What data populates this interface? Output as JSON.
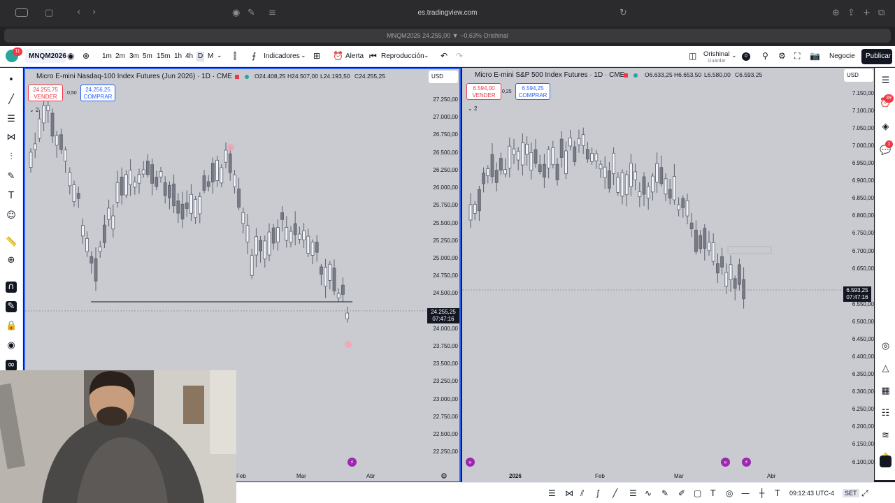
{
  "browser": {
    "url": "es.tradingview.com",
    "tab_title": "MNQM2026 24.255,00 ▼ −0.63% Orishinal"
  },
  "toolbar": {
    "symbol": "MNQM2026",
    "intervals": [
      "1m",
      "2m",
      "3m",
      "5m",
      "15m",
      "1h",
      "4h",
      "D",
      "M"
    ],
    "indicators_label": "Indicadores",
    "alert_label": "Alerta",
    "replay_label": "Reproducción",
    "layout_name": "Orishinal",
    "layout_sub": "Guardar",
    "layout_count": "0",
    "trade_label": "Negocie",
    "publish_label": "Publicar",
    "notif_count": "11"
  },
  "right_badges": {
    "alerts": "39",
    "chat": "1"
  },
  "left_pane": {
    "title": "Micro E-mini Nasdaq-100 Index Futures (Jun 2026) · 1D · CME",
    "open": "O24.408,25",
    "high": "H24.507,00",
    "low": "L24.193,50",
    "close": "C24.255,25",
    "sell_price": "24.255,75",
    "sell_label": "VENDER",
    "buy_price": "24.256,25",
    "buy_label": "COMPRAR",
    "spread": "0,50",
    "badge": "2",
    "currency": "USD",
    "ticks": [
      "27.250,00",
      "27.000,00",
      "26.750,00",
      "26.500,00",
      "26.250,00",
      "26.000,00",
      "25.750,00",
      "25.500,00",
      "25.250,00",
      "25.000,00",
      "24.750,00",
      "24.500,00",
      "24.000,00",
      "23.750,00",
      "23.500,00",
      "23.250,00",
      "23.000,00",
      "22.750,00",
      "22.500,00",
      "22.250,00"
    ],
    "last_price": "24.255,25",
    "countdown": "07:47:16",
    "x_labels": [
      "Feb",
      "Mar",
      "Abr"
    ]
  },
  "right_pane": {
    "title": "Micro E-mini S&P 500 Index Futures · 1D · CME",
    "open": "O6.633,25",
    "high": "H6.653,50",
    "low": "L6.580,00",
    "close": "C6.593,25",
    "sell_price": "6.594,00",
    "sell_label": "VENDER",
    "buy_price": "6.594,25",
    "buy_label": "COMPRAR",
    "spread": "0,25",
    "badge": "2",
    "currency": "USD",
    "ticks": [
      "7.150,00",
      "7.100,00",
      "7.050,00",
      "7.000,00",
      "6.950,00",
      "6.900,00",
      "6.850,00",
      "6.800,00",
      "6.750,00",
      "6.700,00",
      "6.650,00",
      "6.550,00",
      "6.500,00",
      "6.450,00",
      "6.400,00",
      "6.350,00",
      "6.300,00",
      "6.250,00",
      "6.200,00",
      "6.150,00",
      "6.100,00"
    ],
    "last_price": "6.593,25",
    "countdown": "07:47:16",
    "x_labels": [
      "2026",
      "Feb",
      "Mar",
      "Abr"
    ]
  },
  "bottom": {
    "clock": "09:12:43 UTC-4",
    "session": "SET"
  },
  "colors": {
    "accent": "#2962ff",
    "sell": "#f23645",
    "pane_bg": "#c9cbd1",
    "candle": "#787b86"
  }
}
